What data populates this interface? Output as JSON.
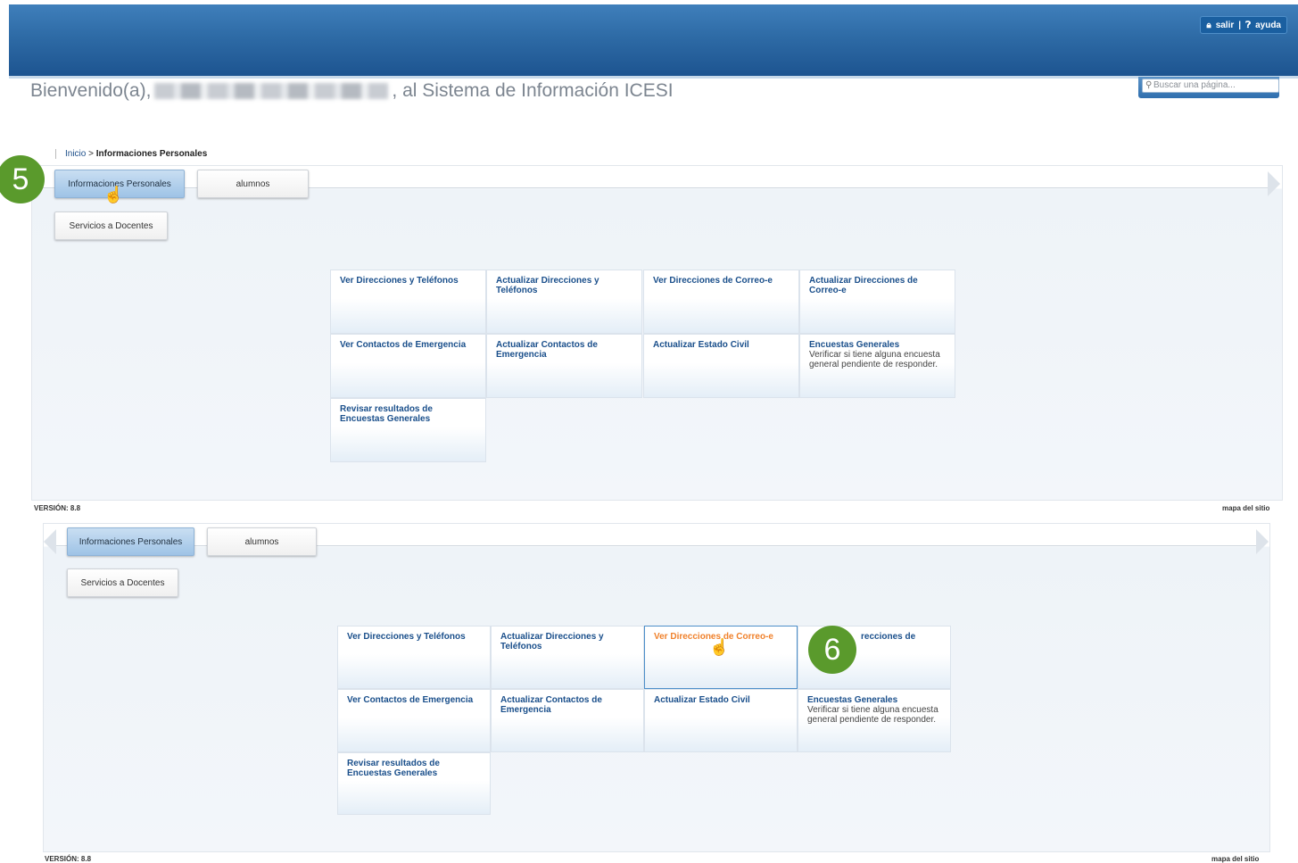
{
  "header": {
    "salir_label": "salir",
    "ayuda_label": "ayuda",
    "welcome_prefix": "Bienvenido(a),",
    "welcome_suffix": ", al Sistema de Información ICESI",
    "search_placeholder": "Buscar una página..."
  },
  "breadcrumb": {
    "home": "Inicio",
    "separator": ">",
    "current": "Informaciones Personales"
  },
  "tabs": {
    "personal": "Informaciones Personales",
    "alumnos": "alumnos",
    "docentes": "Servicios a Docentes"
  },
  "tiles": [
    {
      "title": "Ver Direcciones y Teléfonos",
      "desc": ""
    },
    {
      "title": "Actualizar Direcciones y Teléfonos",
      "desc": ""
    },
    {
      "title": "Ver Direcciones de Correo-e",
      "desc": ""
    },
    {
      "title": "Actualizar Direcciones de Correo-e",
      "desc": ""
    },
    {
      "title": "Ver Contactos de Emergencia",
      "desc": ""
    },
    {
      "title": "Actualizar Contactos de Emergencia",
      "desc": ""
    },
    {
      "title": "Actualizar Estado Civil",
      "desc": ""
    },
    {
      "title": "Encuestas Generales",
      "desc": "Verificar si tiene alguna encuesta general pendiente de responder."
    },
    {
      "title": "Revisar resultados de Encuestas Generales",
      "desc": ""
    }
  ],
  "tile6_partial": "recciones de",
  "footer": {
    "version": "VERSIÓN: 8.8",
    "mapa": "mapa del sitio"
  },
  "badges": {
    "step5": "5",
    "step6": "6"
  },
  "colors": {
    "header": "#2e6ba6",
    "link": "#1a4f8b",
    "hover_link": "#f0812b",
    "badge": "#5a9a2c"
  }
}
